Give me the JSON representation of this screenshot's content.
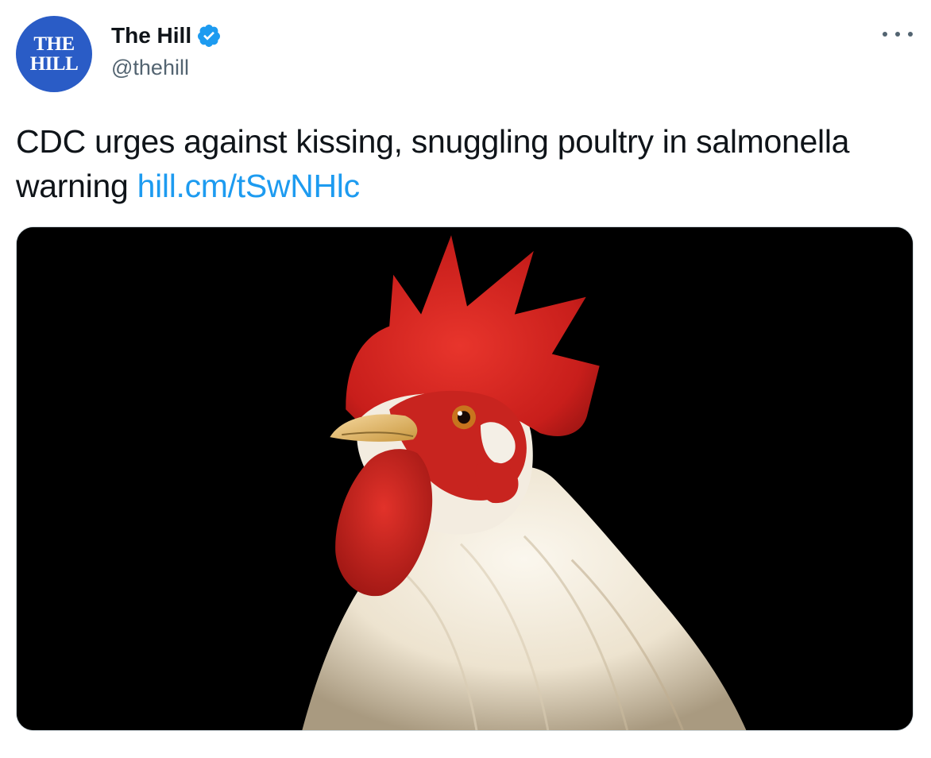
{
  "author": {
    "display_name": "The Hill",
    "handle": "@thehill",
    "avatar_text_line1": "THE",
    "avatar_text_line2": "HILL",
    "verified": true,
    "avatar_color": "#2a5cc6"
  },
  "tweet": {
    "text": "CDC urges against kissing, snuggling poultry in salmonella warning ",
    "link": "hill.cm/tSwNHlc",
    "link_color": "#1d9bf0"
  },
  "media": {
    "subject": "rooster-photo",
    "background": "#000000"
  },
  "icons": {
    "verified": "verified-badge-icon",
    "more": "more-horizontal-icon"
  }
}
